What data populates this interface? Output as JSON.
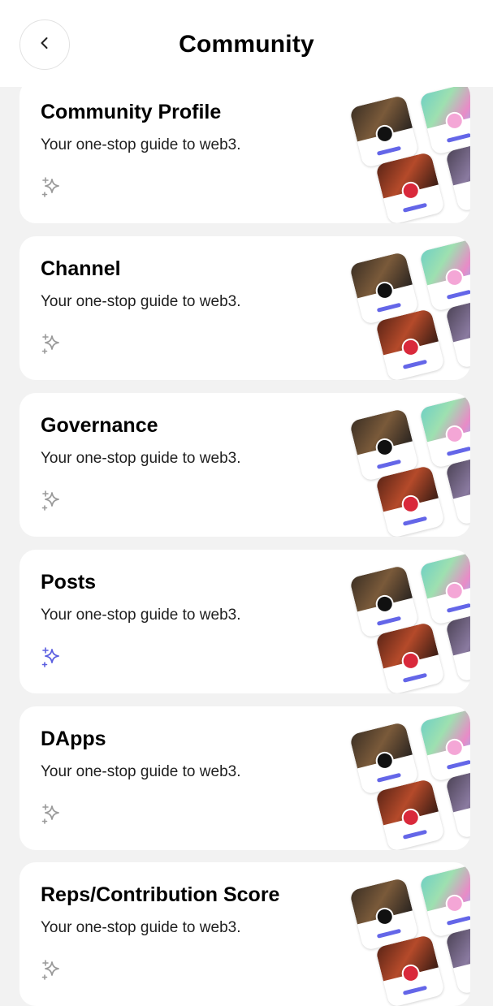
{
  "header": {
    "title": "Community",
    "back_icon": "chevron-left-icon"
  },
  "colors": {
    "accent": "#5b5fe0",
    "icon_inactive": "#9a9a9a",
    "background": "#f2f2f2"
  },
  "cards": [
    {
      "title": "Community Profile",
      "subtitle": "Your one-stop guide to web3.",
      "icon": "sparkle-icon",
      "active": false
    },
    {
      "title": "Channel",
      "subtitle": "Your one-stop guide to web3.",
      "icon": "sparkle-icon",
      "active": false
    },
    {
      "title": "Governance",
      "subtitle": "Your one-stop guide to web3.",
      "icon": "sparkle-icon",
      "active": false
    },
    {
      "title": "Posts",
      "subtitle": "Your one-stop guide to web3.",
      "icon": "sparkle-icon",
      "active": true
    },
    {
      "title": "DApps",
      "subtitle": "Your one-stop guide to web3.",
      "icon": "sparkle-icon",
      "active": false
    },
    {
      "title": "Reps/Contribution Score",
      "subtitle": "Your one-stop guide to web3.",
      "icon": "sparkle-icon",
      "active": false
    }
  ]
}
